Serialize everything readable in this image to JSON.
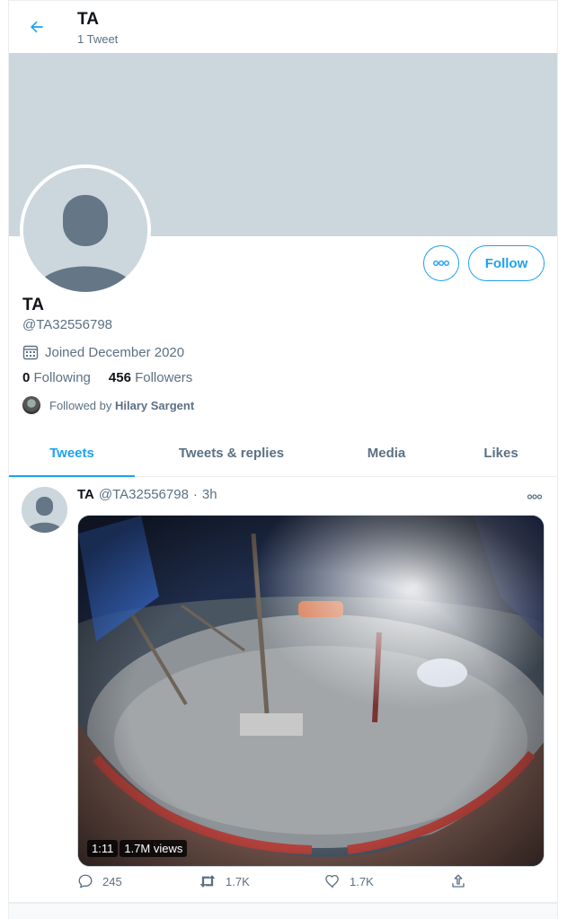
{
  "header": {
    "title": "TA",
    "subtitle": "1 Tweet"
  },
  "profile": {
    "name": "TA",
    "handle": "@TA32556798",
    "joined": "Joined December 2020",
    "following_count": "0",
    "following_label": "Following",
    "followers_count": "456",
    "followers_label": "Followers",
    "followed_by_prefix": "Followed by",
    "followed_by_name": "Hilary Sargent",
    "follow_button": "Follow"
  },
  "tabs": [
    {
      "label": "Tweets",
      "active": true
    },
    {
      "label": "Tweets & replies",
      "active": false
    },
    {
      "label": "Media",
      "active": false
    },
    {
      "label": "Likes",
      "active": false
    }
  ],
  "tweet": {
    "name": "TA",
    "handle": "@TA32556798",
    "separator": "·",
    "time": "3h",
    "video_duration": "1:11",
    "video_views": "1.7M views",
    "replies": "245",
    "retweets": "1.7K",
    "likes": "1.7K"
  },
  "colors": {
    "accent": "#1da1f2",
    "muted": "#5b7083",
    "banner": "#ccd6dd"
  },
  "icons": [
    "back-arrow-icon",
    "calendar-icon",
    "more-icon",
    "reply-icon",
    "retweet-icon",
    "like-icon",
    "share-icon"
  ]
}
